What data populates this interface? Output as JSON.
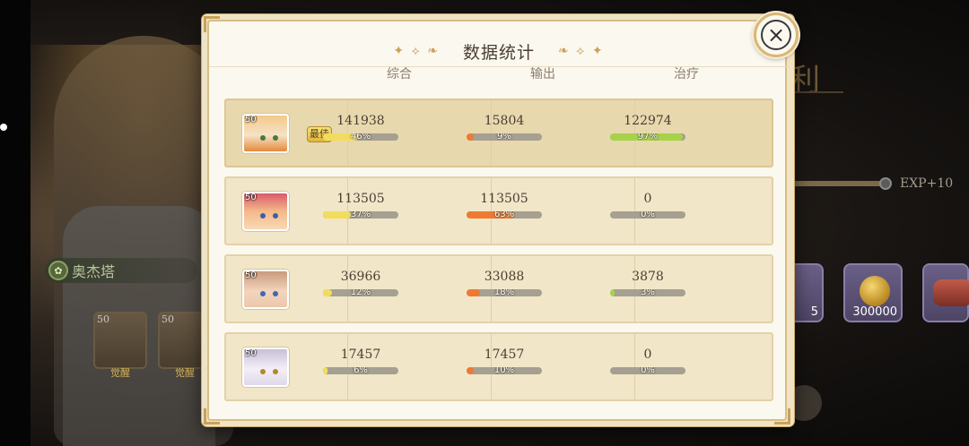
{
  "dialog": {
    "title": "数据统计",
    "title_ornament_left": "✦ ⟡ ❧",
    "title_ornament_right": "❧ ⟡ ✦",
    "close_icon": "×",
    "best_badge": "最佳"
  },
  "columns": [
    "综合",
    "输出",
    "治疗"
  ],
  "rows": [
    {
      "level": "50",
      "best": true,
      "stats": [
        {
          "value": "141938",
          "pct": 46,
          "pct_label": "46%"
        },
        {
          "value": "15804",
          "pct": 9,
          "pct_label": "9%"
        },
        {
          "value": "122974",
          "pct": 97,
          "pct_label": "97%"
        }
      ]
    },
    {
      "level": "50",
      "best": false,
      "stats": [
        {
          "value": "113505",
          "pct": 37,
          "pct_label": "37%"
        },
        {
          "value": "113505",
          "pct": 63,
          "pct_label": "63%"
        },
        {
          "value": "0",
          "pct": 0,
          "pct_label": "0%"
        }
      ]
    },
    {
      "level": "50",
      "best": false,
      "stats": [
        {
          "value": "36966",
          "pct": 12,
          "pct_label": "12%"
        },
        {
          "value": "33088",
          "pct": 18,
          "pct_label": "18%"
        },
        {
          "value": "3878",
          "pct": 3,
          "pct_label": "3%"
        }
      ]
    },
    {
      "level": "50",
      "best": false,
      "stats": [
        {
          "value": "17457",
          "pct": 6,
          "pct_label": "6%"
        },
        {
          "value": "17457",
          "pct": 10,
          "pct_label": "10%"
        },
        {
          "value": "0",
          "pct": 0,
          "pct_label": "0%"
        }
      ]
    }
  ],
  "background": {
    "character_name": "奥杰塔",
    "title_fragment": "利",
    "exp_label": "EXP+10",
    "team": [
      {
        "level": "50",
        "label": "觉醒"
      },
      {
        "level": "50",
        "label": "觉醒"
      }
    ],
    "rewards": [
      {
        "count": "5",
        "icon": "ticket-icon"
      },
      {
        "count": "300000",
        "icon": "gold-coin-icon"
      },
      {
        "count": "",
        "icon": "meat-icon"
      }
    ]
  },
  "colors": {
    "bar_total": "#f2dc5e",
    "bar_damage": "#ee7a32",
    "bar_heal": "#a6d24a",
    "bar_track": "#a6a092",
    "accent_gold": "#c9a15a"
  }
}
